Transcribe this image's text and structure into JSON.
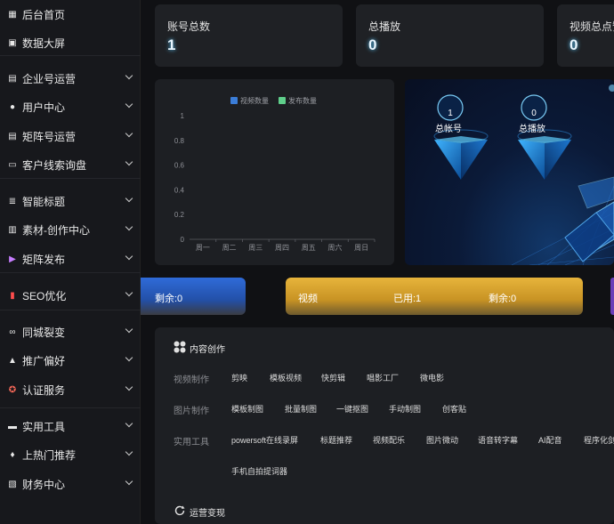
{
  "sidebar": {
    "items": [
      {
        "label": "后台首页",
        "icon": "grid-icon",
        "chevron": false
      },
      {
        "label": "数据大屏",
        "icon": "image-icon",
        "chevron": false
      },
      {
        "label": "企业号运营",
        "icon": "document-icon",
        "chevron": true
      },
      {
        "label": "用户中心",
        "icon": "user-icon",
        "chevron": true
      },
      {
        "label": "矩阵号运营",
        "icon": "document-icon",
        "chevron": true
      },
      {
        "label": "客户线索询盘",
        "icon": "id-card-icon",
        "chevron": true
      },
      {
        "label": "智能标题",
        "icon": "list-icon",
        "chevron": true
      },
      {
        "label": "素材-创作中心",
        "icon": "save-icon",
        "chevron": true
      },
      {
        "label": "矩阵发布",
        "icon": "video-icon",
        "chevron": true
      },
      {
        "label": "SEO优化",
        "icon": "chart-icon",
        "chevron": true
      },
      {
        "label": "同城裂变",
        "icon": "link-icon",
        "chevron": true
      },
      {
        "label": "推广偏好",
        "icon": "thumb-up-icon",
        "chevron": true
      },
      {
        "label": "认证服务",
        "icon": "badge-icon",
        "chevron": true
      },
      {
        "label": "实用工具",
        "icon": "toolbox-icon",
        "chevron": true
      },
      {
        "label": "上热门推荐",
        "icon": "fire-icon",
        "chevron": true
      },
      {
        "label": "财务中心",
        "icon": "wallet-icon",
        "chevron": true
      }
    ]
  },
  "stats": [
    {
      "label": "账号总数",
      "value": "1"
    },
    {
      "label": "总播放",
      "value": "0"
    },
    {
      "label": "视频总点赞",
      "value": "0"
    }
  ],
  "chart_data": {
    "type": "bar",
    "categories": [
      "周一",
      "周二",
      "周三",
      "周四",
      "周五",
      "周六",
      "周日"
    ],
    "series": [
      {
        "name": "视频数量",
        "values": [
          0,
          0,
          0,
          0,
          0,
          0,
          0
        ],
        "color": "#3b7dd8"
      },
      {
        "name": "发布数量",
        "values": [
          0,
          0,
          0,
          0,
          0,
          0,
          0
        ],
        "color": "#5fcf8b"
      }
    ],
    "yticks": [
      "0",
      "0.2",
      "0.4",
      "0.6",
      "0.8",
      "1"
    ],
    "ylim": [
      0,
      1
    ],
    "legend": "top"
  },
  "screen": {
    "badges": [
      {
        "value": "1",
        "label": "总帐号"
      },
      {
        "value": "0",
        "label": "总播放"
      }
    ]
  },
  "quota": {
    "left": {
      "text": "剩余:0"
    },
    "video": {
      "name": "视频",
      "used": "已用:1",
      "remain": "剩余:0"
    }
  },
  "content": {
    "title": "内容创作",
    "rows": [
      {
        "label": "视频制作",
        "tools": [
          "剪映",
          "模板视频",
          "快剪辑",
          "唱影工厂",
          "微电影"
        ]
      },
      {
        "label": "图片制作",
        "tools": [
          "模板制图",
          "批量制图",
          "一键抠图",
          "手动制图",
          "创客贴"
        ]
      },
      {
        "label": "实用工具",
        "tools": [
          "powersoft在线录屏",
          "标题推荐",
          "视频配乐",
          "图片微动",
          "语音转字幕",
          "AI配音",
          "程序化剑"
        ]
      }
    ],
    "extra_tool": "手机自拍提词器",
    "section2_title": "运营变现"
  }
}
